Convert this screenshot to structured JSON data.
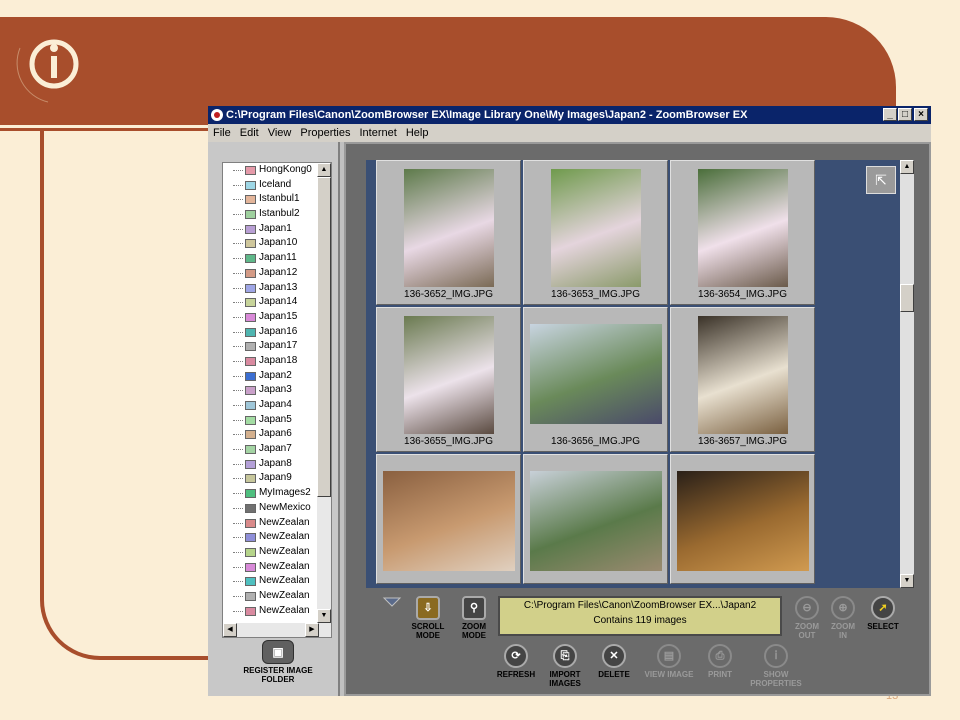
{
  "window": {
    "title": "C:\\Program Files\\Canon\\ZoomBrowser EX\\Image Library One\\My Images\\Japan2 - ZoomBrowser EX",
    "controls": {
      "minimize": "_",
      "maximize": "□",
      "close": "×"
    }
  },
  "menu": [
    "File",
    "Edit",
    "View",
    "Properties",
    "Internet",
    "Help"
  ],
  "folders": [
    {
      "label": "HongKong0",
      "color": "#e59aa9"
    },
    {
      "label": "Iceland",
      "color": "#9ed7e6"
    },
    {
      "label": "Istanbul1",
      "color": "#e3b59a"
    },
    {
      "label": "Istanbul2",
      "color": "#9fd19f"
    },
    {
      "label": "Japan1",
      "color": "#b89fd4"
    },
    {
      "label": "Japan10",
      "color": "#cfc79c"
    },
    {
      "label": "Japan11",
      "color": "#5fb88a"
    },
    {
      "label": "Japan12",
      "color": "#d49b86"
    },
    {
      "label": "Japan13",
      "color": "#9fa6e6"
    },
    {
      "label": "Japan14",
      "color": "#c7d49a"
    },
    {
      "label": "Japan15",
      "color": "#d98ad8"
    },
    {
      "label": "Japan16",
      "color": "#4fb5b0"
    },
    {
      "label": "Japan17",
      "color": "#b0b0b0"
    },
    {
      "label": "Japan18",
      "color": "#d98aa0"
    },
    {
      "label": "Japan2",
      "color": "#3b6ed1"
    },
    {
      "label": "Japan3",
      "color": "#c9a0c9"
    },
    {
      "label": "Japan4",
      "color": "#9fc7d9"
    },
    {
      "label": "Japan5",
      "color": "#a3dca3"
    },
    {
      "label": "Japan6",
      "color": "#d4b08e"
    },
    {
      "label": "Japan7",
      "color": "#a4d4a4"
    },
    {
      "label": "Japan8",
      "color": "#b4a0d8"
    },
    {
      "label": "Japan9",
      "color": "#c7c79c"
    },
    {
      "label": "MyImages2",
      "color": "#4fbf7f"
    },
    {
      "label": "NewMexico",
      "color": "#707070"
    },
    {
      "label": "NewZealan",
      "color": "#d98a8a"
    },
    {
      "label": "NewZealan",
      "color": "#8f8fd9"
    },
    {
      "label": "NewZealan",
      "color": "#b5d48a"
    },
    {
      "label": "NewZealan",
      "color": "#d88ad8"
    },
    {
      "label": "NewZealan",
      "color": "#4fc0c0"
    },
    {
      "label": "NewZealan",
      "color": "#b0b0b0"
    },
    {
      "label": "NewZealan",
      "color": "#d98aa0"
    }
  ],
  "register": {
    "label": "REGISTER IMAGE FOLDER"
  },
  "thumbnails": [
    {
      "name": "136-3652_IMG.JPG",
      "orientation": "portrait"
    },
    {
      "name": "136-3653_IMG.JPG",
      "orientation": "portrait"
    },
    {
      "name": "136-3654_IMG.JPG",
      "orientation": "portrait"
    },
    {
      "name": "136-3655_IMG.JPG",
      "orientation": "portrait"
    },
    {
      "name": "136-3656_IMG.JPG",
      "orientation": "landscape"
    },
    {
      "name": "136-3657_IMG.JPG",
      "orientation": "portrait"
    },
    {
      "name": "",
      "orientation": "landscape"
    },
    {
      "name": "",
      "orientation": "landscape"
    },
    {
      "name": "",
      "orientation": "landscape"
    }
  ],
  "status": {
    "path": "C:\\Program Files\\Canon\\ZoomBrowser EX...\\Japan2",
    "count": "Contains 119 images"
  },
  "controls": {
    "scroll_mode": "SCROLL MODE",
    "zoom_mode": "ZOOM MODE",
    "zoom_out": "ZOOM OUT",
    "zoom_in": "ZOOM IN",
    "select": "SELECT",
    "refresh": "REFRESH",
    "import_images": "IMPORT IMAGES",
    "delete": "DELETE",
    "view_image": "VIEW IMAGE",
    "print": "PRINT",
    "show_properties": "SHOW PROPERTIES"
  },
  "slide": {
    "page_number": "13",
    "brand_color": "#a84e2c",
    "background_color": "#fbeed6"
  }
}
